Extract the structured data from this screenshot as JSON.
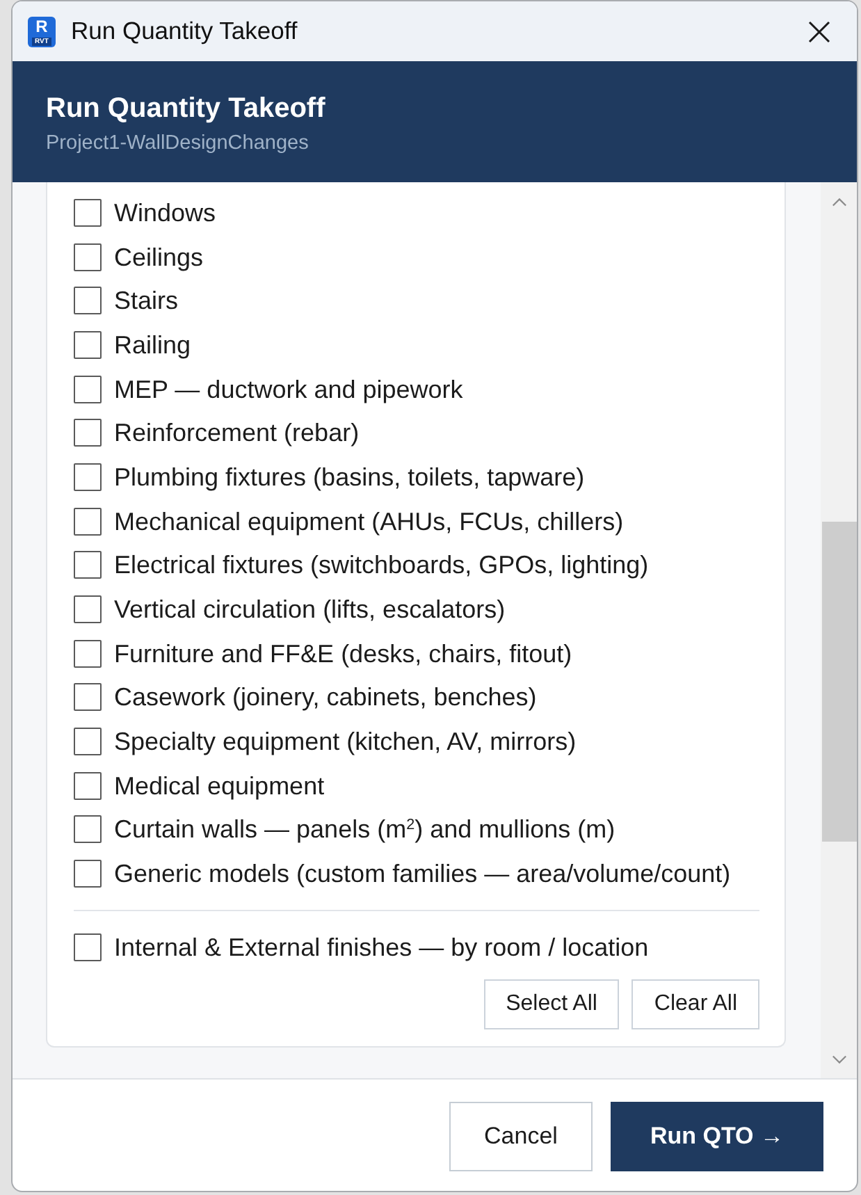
{
  "window": {
    "title": "Run Quantity Takeoff",
    "app_logo": {
      "letter": "R",
      "caption": "RVT"
    }
  },
  "header": {
    "title": "Run Quantity Takeoff",
    "subtitle": "Project1-WallDesignChanges"
  },
  "categories": [
    {
      "label": "Windows",
      "checked": false
    },
    {
      "label": "Ceilings",
      "checked": false
    },
    {
      "label": "Stairs",
      "checked": false
    },
    {
      "label": "Railing",
      "checked": false
    },
    {
      "label": "MEP — ductwork and pipework",
      "checked": false
    },
    {
      "label": "Reinforcement (rebar)",
      "checked": false
    },
    {
      "label": "Plumbing fixtures (basins, toilets, tapware)",
      "checked": false
    },
    {
      "label": "Mechanical equipment (AHUs, FCUs, chillers)",
      "checked": false
    },
    {
      "label": "Electrical fixtures (switchboards, GPOs, lighting)",
      "checked": false
    },
    {
      "label": "Vertical circulation (lifts, escalators)",
      "checked": false
    },
    {
      "label": "Furniture and FF&E (desks, chairs, fitout)",
      "checked": false
    },
    {
      "label": "Casework (joinery, cabinets, benches)",
      "checked": false
    },
    {
      "label": "Specialty equipment (kitchen, AV, mirrors)",
      "checked": false
    },
    {
      "label": "Medical equipment",
      "checked": false
    },
    {
      "label": "Curtain walls — panels (m$^{2}$) and mullions (m)",
      "checked": false
    },
    {
      "label": "Generic models (custom families — area/volume/count)",
      "checked": false
    }
  ],
  "finishes": [
    {
      "label": "Internal & External finishes — by room / location",
      "checked": false
    }
  ],
  "card_buttons": [
    "Select All",
    "Clear All"
  ],
  "footer_buttons": [
    {
      "label": "Cancel",
      "kind": "secondary"
    },
    {
      "label": "Run QTO →",
      "kind": "primary"
    }
  ]
}
